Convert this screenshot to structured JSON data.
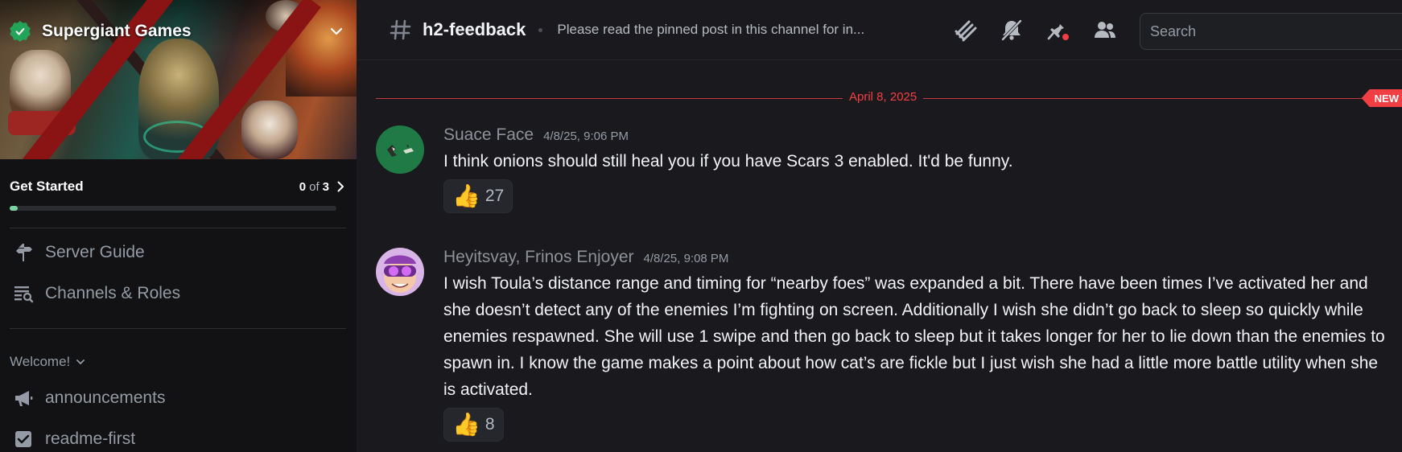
{
  "server": {
    "name": "Supergiant Games"
  },
  "get_started": {
    "title": "Get Started",
    "done": "0",
    "of": "of",
    "total": "3",
    "progress_fraction": 0.02
  },
  "nav": {
    "server_guide": "Server Guide",
    "channels_roles": "Channels & Roles"
  },
  "category": {
    "label": "Welcome!"
  },
  "channels": [
    {
      "name": "announcements"
    },
    {
      "name": "readme-first"
    }
  ],
  "header": {
    "channel_name": "h2-feedback",
    "topic": "Please read the pinned post in this channel for in...",
    "search_placeholder": "Search"
  },
  "divider": {
    "date": "April 8, 2025",
    "new_label": "NEW"
  },
  "messages": [
    {
      "username": "Suace Face",
      "timestamp": "4/8/25, 9:06 PM",
      "text": "I think onions should still heal you if you have Scars 3 enabled. It'd be funny.",
      "reaction_emoji": "👍",
      "reaction_count": "27"
    },
    {
      "username": "Heyitsvay, Frinos Enjoyer",
      "timestamp": "4/8/25, 9:08 PM",
      "text": "I wish Toula’s distance range and timing for “nearby foes” was expanded a bit. There have been times I’ve activated her and she doesn’t detect any of the  enemies I’m fighting on screen. Additionally I wish she didn’t go back to sleep so quickly while enemies respawned. She will use 1 swipe and then go back to sleep but it takes longer for her to lie down than the enemies to spawn in. I know the game makes a point about how cat’s are fickle but I just wish she had a little more battle utility when she is activated.",
      "reaction_emoji": "👍",
      "reaction_count": "8"
    }
  ],
  "colors": {
    "accent_green": "#23a559",
    "new_red": "#f23f43",
    "background": "#1a1a1e",
    "sidebar": "#121214"
  },
  "icons": {
    "verified": "verified-badge-icon",
    "server_menu": "chevron-down-icon",
    "threads": "threads-icon",
    "mute": "bell-muted-icon",
    "pins": "pin-icon",
    "members": "members-icon"
  }
}
